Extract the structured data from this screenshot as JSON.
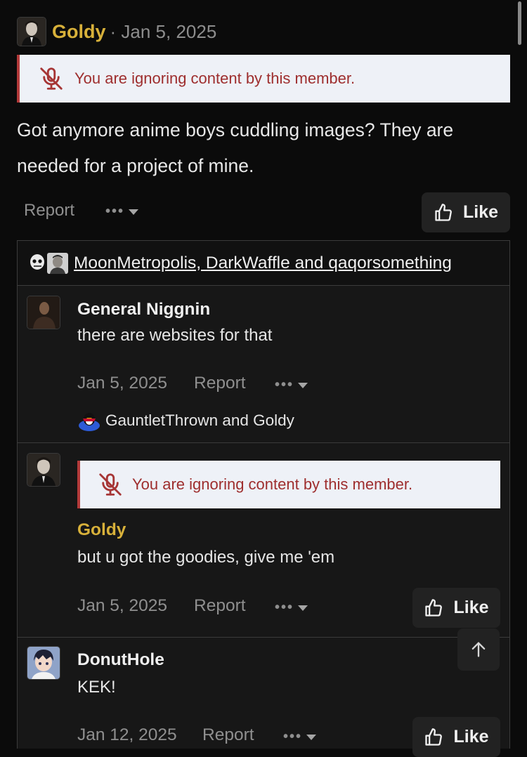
{
  "post": {
    "author": "Goldy",
    "date_sep": "· Jan 5, 2025",
    "ignore_notice": "You are ignoring content by this member.",
    "body": "Got anymore anime boys cuddling images? They are needed for a project of mine.",
    "report_label": "Report",
    "more_label": "•••",
    "like_label": "Like"
  },
  "reactions": {
    "users_text": "MoonMetropolis, DarkWaffle and qaqorsomething"
  },
  "comments": [
    {
      "author": "General Niggnin",
      "text": "there are websites for that",
      "date": "Jan 5, 2025",
      "report_label": "Report",
      "more_label": "•••",
      "reactors": "GauntletThrown and Goldy"
    },
    {
      "ignore_notice": "You are ignoring content by this member.",
      "author": "Goldy",
      "text": "but u got the goodies, give me 'em",
      "date": "Jan 5, 2025",
      "report_label": "Report",
      "more_label": "•••",
      "like_label": "Like"
    },
    {
      "author": "DonutHole",
      "text": "KEK!",
      "date": "Jan 12, 2025",
      "report_label": "Report",
      "more_label": "•••",
      "like_label": "Like"
    }
  ],
  "colors": {
    "background": "#0b0b0b",
    "author_highlight": "#d8b13a",
    "notice_bg": "#eef1f7",
    "notice_text": "#9e2e2e",
    "button_bg": "#222222"
  },
  "icons": [
    "mic-off-icon",
    "thumbs-up-icon",
    "chevron-down-icon",
    "arrow-up-icon"
  ]
}
